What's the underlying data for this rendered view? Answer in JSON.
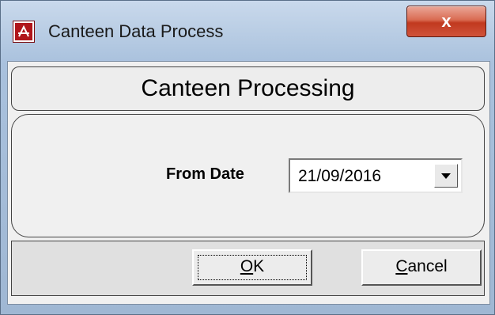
{
  "window": {
    "title": "Canteen Data Process",
    "close_label": "x",
    "icon": "app-document-icon"
  },
  "header": {
    "title": "Canteen Processing"
  },
  "form": {
    "from_date_label": "From Date",
    "from_date_value": "21/09/2016",
    "dropdown_icon": "triangle-down-icon"
  },
  "buttons": {
    "ok_accel": "O",
    "ok_rest": "K",
    "cancel_accel": "C",
    "cancel_rest": "ancel"
  }
}
